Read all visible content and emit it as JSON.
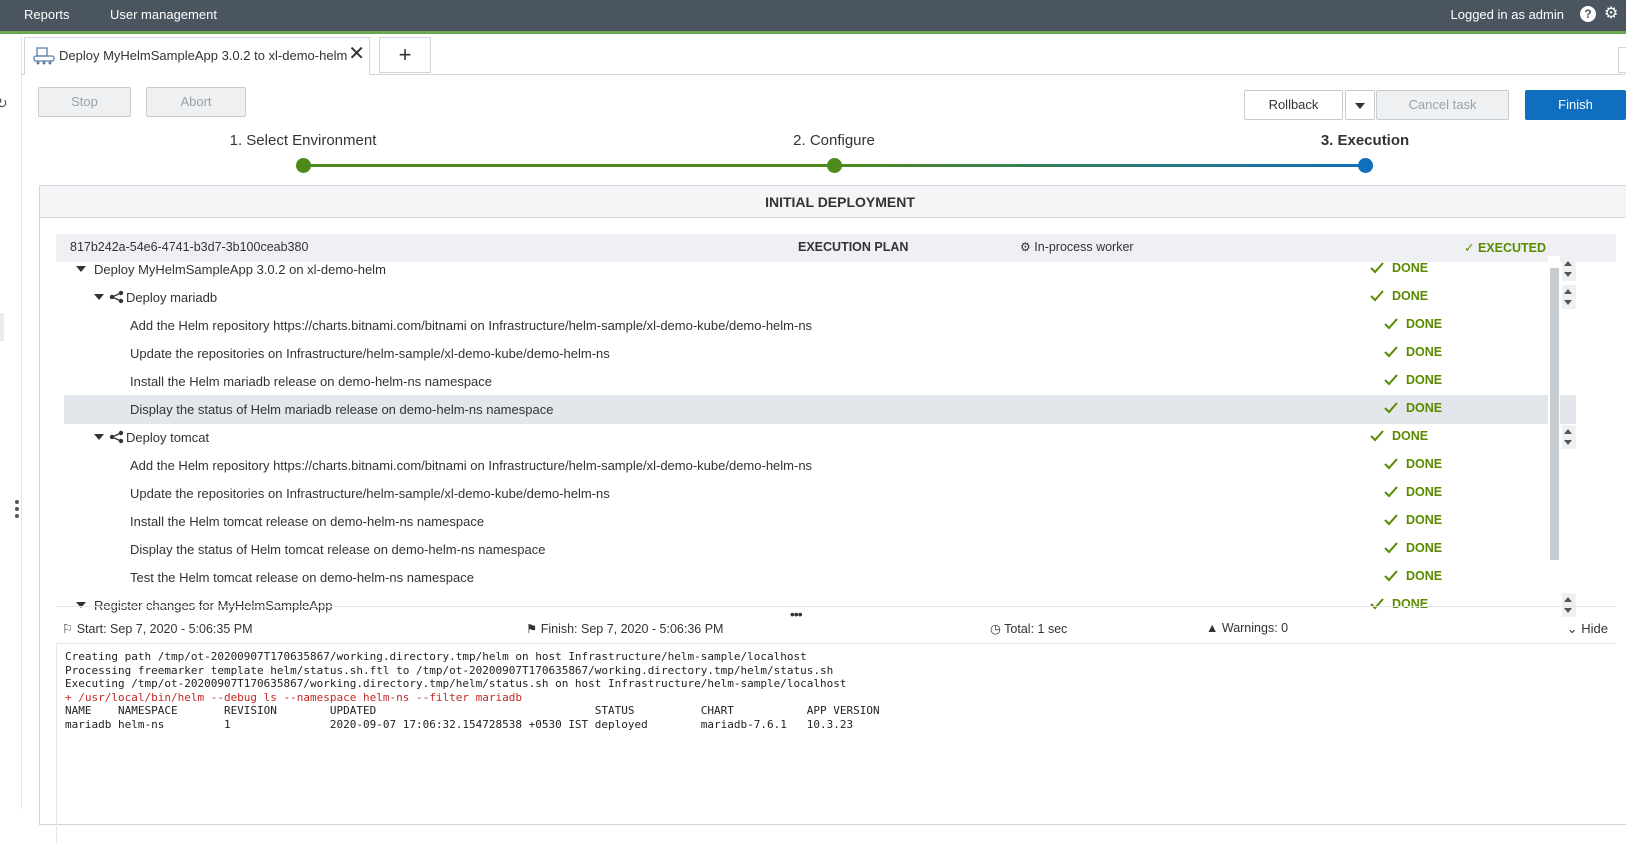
{
  "topnav": {
    "links": [
      "Reports",
      "User management"
    ],
    "user": "Logged in as admin",
    "help_icon": "help-icon",
    "settings_icon": "gear-icon"
  },
  "tabs": {
    "active_label": "Deploy MyHelmSampleApp 3.0.2 to xl-demo-helm",
    "add_label": "+",
    "close_label": "✕"
  },
  "actions": {
    "stop": "Stop",
    "abort": "Abort",
    "rollback": "Rollback",
    "cancel_task": "Cancel task",
    "finish": "Finish"
  },
  "stepper": {
    "steps": [
      "1. Select Environment",
      "2. Configure",
      "3. Execution"
    ],
    "active_step": 3
  },
  "panel": {
    "title": "INITIAL DEPLOYMENT",
    "plan_id": "817b242a-54e6-4741-b3d7-3b100ceab380",
    "plan_title": "EXECUTION PLAN",
    "worker": "In-process worker",
    "plan_status": "EXECUTED"
  },
  "tree": [
    {
      "label": "Deploy MyHelmSampleApp 3.0.2 on xl-demo-helm",
      "status": "DONE"
    },
    {
      "label": "Deploy mariadb",
      "status": "DONE"
    },
    {
      "label": "Add the Helm repository https://charts.bitnami.com/bitnami on Infrastructure/helm-sample/xl-demo-kube/demo-helm-ns",
      "status": "DONE"
    },
    {
      "label": "Update the repositories on Infrastructure/helm-sample/xl-demo-kube/demo-helm-ns",
      "status": "DONE"
    },
    {
      "label": "Install the Helm mariadb release on demo-helm-ns namespace",
      "status": "DONE"
    },
    {
      "label": "Display the status of Helm mariadb release on demo-helm-ns namespace",
      "status": "DONE"
    },
    {
      "label": "Deploy tomcat",
      "status": "DONE"
    },
    {
      "label": "Add the Helm repository https://charts.bitnami.com/bitnami on Infrastructure/helm-sample/xl-demo-kube/demo-helm-ns",
      "status": "DONE"
    },
    {
      "label": "Update the repositories on Infrastructure/helm-sample/xl-demo-kube/demo-helm-ns",
      "status": "DONE"
    },
    {
      "label": "Install the Helm tomcat release on demo-helm-ns namespace",
      "status": "DONE"
    },
    {
      "label": "Display the status of Helm tomcat release on demo-helm-ns namespace",
      "status": "DONE"
    },
    {
      "label": "Test the Helm tomcat release on demo-helm-ns namespace",
      "status": "DONE"
    },
    {
      "label": "Register changes for MyHelmSampleApp",
      "status": "DONE"
    }
  ],
  "task_meta": {
    "start": "Start: Sep 7, 2020 - 5:06:35 PM",
    "finish": "Finish: Sep 7, 2020 - 5:06:36 PM",
    "total": "Total: 1 sec",
    "warnings": "Warnings: 0",
    "hide": "Hide"
  },
  "log": {
    "lines": [
      {
        "text": "Creating path /tmp/ot-20200907T170635867/working.directory.tmp/helm on host Infrastructure/helm-sample/localhost",
        "error": false
      },
      {
        "text": "Processing freemarker template helm/status.sh.ftl to /tmp/ot-20200907T170635867/working.directory.tmp/helm/status.sh",
        "error": false
      },
      {
        "text": "Executing /tmp/ot-20200907T170635867/working.directory.tmp/helm/status.sh on host Infrastructure/helm-sample/localhost",
        "error": false
      },
      {
        "text": "+ /usr/local/bin/helm --debug ls --namespace helm-ns --filter mariadb",
        "error": true
      },
      {
        "text": "NAME    NAMESPACE       REVISION        UPDATED                                 STATUS          CHART           APP VERSION",
        "error": false
      },
      {
        "text": "mariadb helm-ns         1               2020-09-07 17:06:32.154728538 +0530 IST deployed        mariadb-7.6.1   10.3.23",
        "error": false
      }
    ]
  },
  "colors": {
    "topbar": "#4b5560",
    "accent_green": "#6aa84f",
    "done_green": "#5a8a00",
    "primary_blue": "#0f6fbe",
    "error_red": "#c62828"
  }
}
